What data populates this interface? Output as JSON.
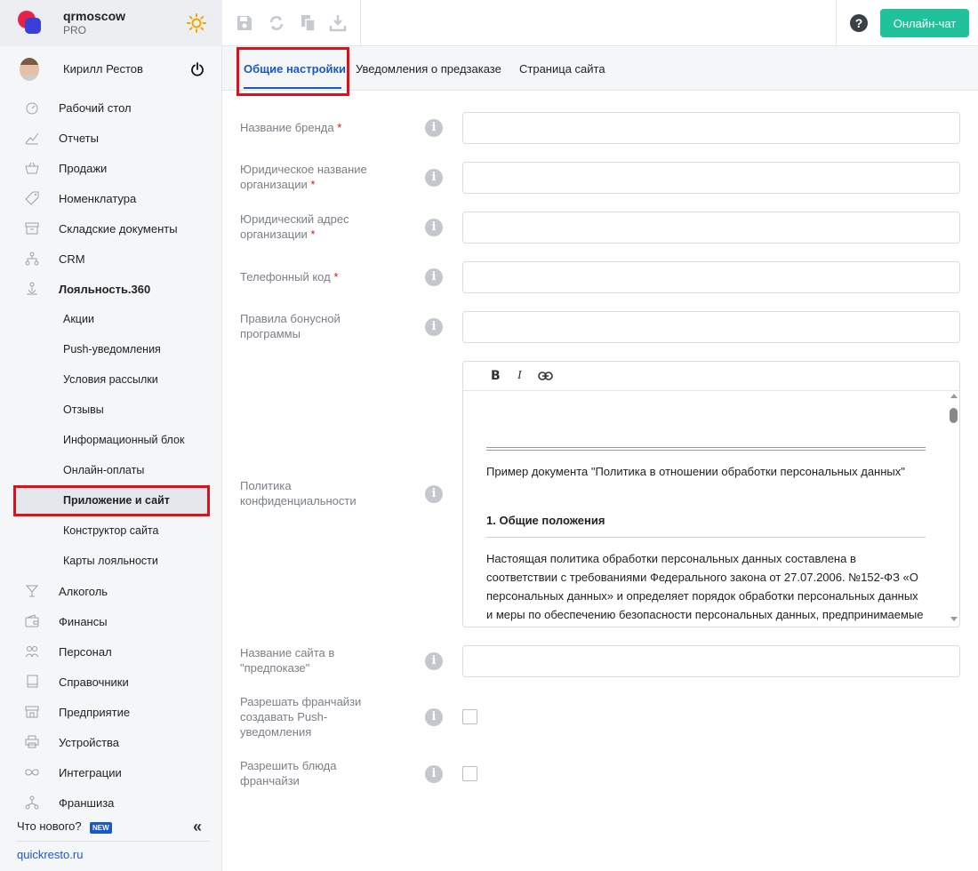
{
  "brand": {
    "name": "qrmoscow",
    "plan": "PRO"
  },
  "user": {
    "name": "Кирилл Рестов"
  },
  "sidebar": {
    "items": [
      {
        "label": "Рабочий стол",
        "icon": "dashboard-icon"
      },
      {
        "label": "Отчеты",
        "icon": "chart-icon"
      },
      {
        "label": "Продажи",
        "icon": "basket-icon"
      },
      {
        "label": "Номенклатура",
        "icon": "tag-icon"
      },
      {
        "label": "Складские документы",
        "icon": "archive-icon"
      },
      {
        "label": "CRM",
        "icon": "hierarchy-icon"
      },
      {
        "label": "Лояльность.360",
        "icon": "loyalty-icon"
      }
    ],
    "subitems": [
      {
        "label": "Акции"
      },
      {
        "label": "Push-уведомления"
      },
      {
        "label": "Условия рассылки"
      },
      {
        "label": "Отзывы"
      },
      {
        "label": "Информационный блок"
      },
      {
        "label": "Онлайн-оплаты"
      },
      {
        "label": "Приложение и сайт"
      },
      {
        "label": "Конструктор сайта"
      },
      {
        "label": "Карты лояльности"
      }
    ],
    "items_after": [
      {
        "label": "Алкоголь",
        "icon": "glass-icon"
      },
      {
        "label": "Финансы",
        "icon": "wallet-icon"
      },
      {
        "label": "Персонал",
        "icon": "people-icon"
      },
      {
        "label": "Справочники",
        "icon": "book-icon"
      },
      {
        "label": "Предприятие",
        "icon": "store-icon"
      },
      {
        "label": "Устройства",
        "icon": "printer-icon"
      },
      {
        "label": "Интеграции",
        "icon": "infinity-icon"
      },
      {
        "label": "Франшиза",
        "icon": "franchise-icon"
      }
    ],
    "whats_new": "Что нового?",
    "new_badge": "NEW",
    "collapse": "«",
    "site_link": "quickresto.ru"
  },
  "header": {
    "help": "?",
    "chat_button": "Онлайн-чат"
  },
  "tabs": [
    {
      "label": "Общие настройки"
    },
    {
      "label": "Уведомления о предзаказе"
    },
    {
      "label": "Страница сайта"
    }
  ],
  "form": {
    "required_mark": "*",
    "brand_name": {
      "label": "Название бренда",
      "value": ""
    },
    "legal_name": {
      "label": "Юридическое название организации",
      "value": ""
    },
    "legal_address": {
      "label": "Юридический адрес организации",
      "value": ""
    },
    "phone_code": {
      "label": "Телефонный код",
      "value": ""
    },
    "bonus_rules": {
      "label": "Правила бонусной программы",
      "value": ""
    },
    "privacy_policy": {
      "label": "Политика конфиденциальности",
      "editor_toolbar": {
        "bold": "B",
        "italic": "I"
      },
      "doc_title": "Пример документа \"Политика в отношении обработки персональных данных\"",
      "heading": "1. Общие положения",
      "body": "Настоящая политика обработки персональных данных составлена в соответствии с требованиями Федерального закона от 27.07.2006. №152-ФЗ «О персональных данных» и определяет порядок обработки персональных данных и меры по обеспечению безопасности персональных данных, предпринимаемые ООО \"Квик Ресто\" (далее – Оператор)."
    },
    "preorder_site_name": {
      "label": "Название сайта в \"предпоказе\"",
      "value": ""
    },
    "allow_franchise_push": {
      "label": "Разрешать франчайзи создавать Push-уведомления",
      "checked": false
    },
    "allow_franchise_dishes": {
      "label": "Разрешить блюда франчайзи",
      "checked": false
    },
    "info_glyph": "i"
  },
  "colors": {
    "accent": "#1a57c9",
    "chat": "#1fc29a",
    "highlight": "#e0101a"
  }
}
